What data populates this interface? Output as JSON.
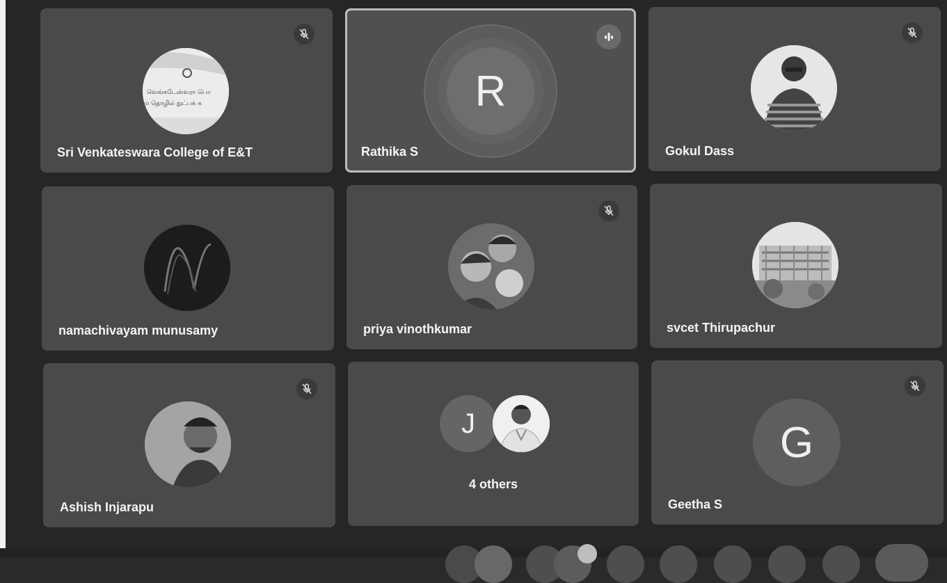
{
  "participants": [
    {
      "name": "Sri Venkateswara College of E&T",
      "muted": true
    },
    {
      "name": "Rathika S",
      "initial": "R",
      "speaking": true
    },
    {
      "name": "Gokul Dass",
      "muted": true
    },
    {
      "name": "namachivayam munusamy"
    },
    {
      "name": "priya vinothkumar",
      "muted": true
    },
    {
      "name": "svcet Thirupachur"
    },
    {
      "name": "Ashish Injarapu",
      "muted": true
    },
    {
      "others_initial": "J",
      "others_label": "4 others"
    },
    {
      "name": "Geetha S",
      "initial": "G",
      "muted": true
    }
  ],
  "profile_sign_text": [
    "வெங்கடேஸ்வரா பொ",
    "ம தொழில் நுட்பக் க"
  ],
  "colors": {
    "tile": "#4a4a4a",
    "active_border": "#bdbdbd",
    "grid_bg": "#262626"
  },
  "icons": [
    "mic-off-icon",
    "audio-level-icon"
  ]
}
